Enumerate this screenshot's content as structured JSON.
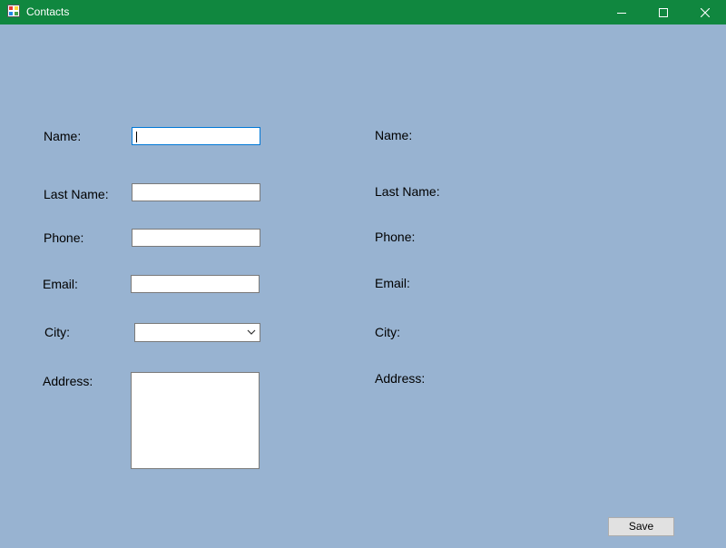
{
  "window": {
    "title": "Contacts",
    "titlebar_color": "#10873f",
    "background_color": "#98b3d1",
    "controls": {
      "minimize_icon": "minimize-icon",
      "maximize_icon": "maximize-icon",
      "close_icon": "close-icon"
    }
  },
  "form": {
    "name_label": "Name:",
    "last_name_label": "Last Name:",
    "phone_label": "Phone:",
    "email_label": "Email:",
    "city_label": "City:",
    "address_label": "Address:",
    "name_value": "",
    "last_name_value": "",
    "phone_value": "",
    "email_value": "",
    "city_value": "",
    "address_value": ""
  },
  "display": {
    "name_label": "Name:",
    "last_name_label": "Last Name:",
    "phone_label": "Phone:",
    "email_label": "Email:",
    "city_label": "City:",
    "address_label": "Address:"
  },
  "actions": {
    "save_label": "Save"
  }
}
